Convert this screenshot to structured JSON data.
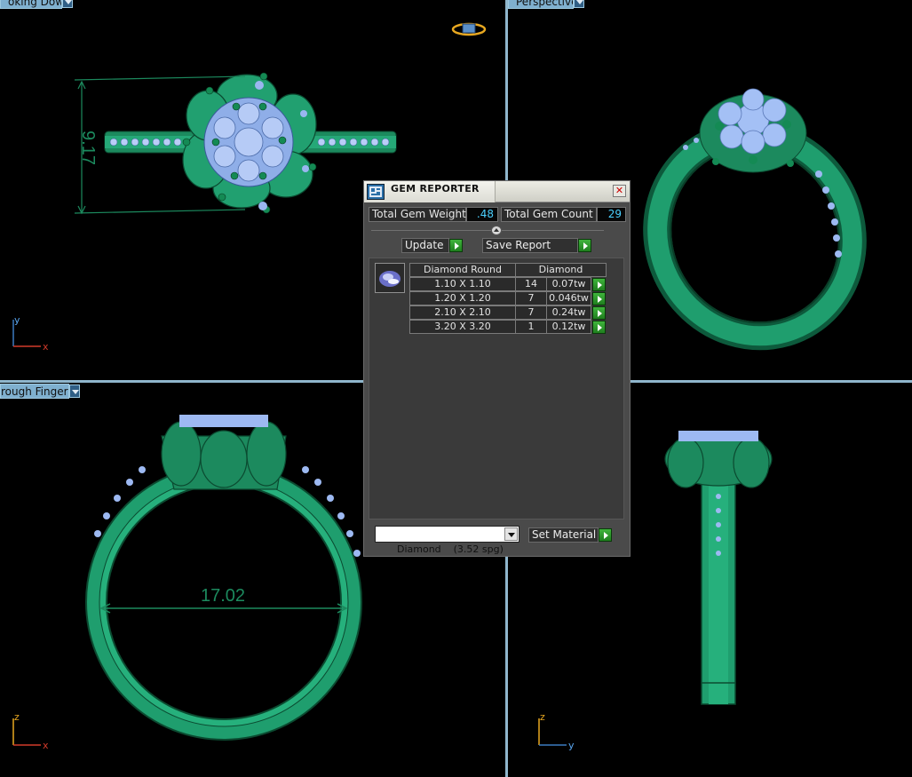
{
  "viewports": {
    "top_left": {
      "label": "oking Down"
    },
    "top_right": {
      "label": "Perspective"
    },
    "bottom_left": {
      "label": "rough Finger"
    }
  },
  "dimensions": {
    "top_view": "9.17",
    "front_view": "17.02"
  },
  "axes": {
    "top_left": {
      "vertical": "y",
      "horizontal": "x"
    },
    "bottom_left": {
      "vertical": "z",
      "horizontal": "x"
    },
    "bottom_right": {
      "vertical": "z",
      "horizontal": "y"
    }
  },
  "gem_reporter": {
    "title": "GEM REPORTER",
    "close_glyph": "✕",
    "total_gem_weight_label": "Total Gem Weight",
    "total_gem_weight": ".48",
    "total_gem_count_label": "Total Gem Count",
    "total_gem_count": "29",
    "update_label": "Update",
    "save_report_label": "Save Report",
    "table": {
      "headers": [
        "Diamond Round",
        "Diamond"
      ],
      "rows": [
        {
          "size": "1.10 X 1.10",
          "count": "14",
          "weight": "0.07tw"
        },
        {
          "size": "1.20 X 1.20",
          "count": "7",
          "weight": "0.046tw"
        },
        {
          "size": "2.10 X 2.10",
          "count": "7",
          "weight": "0.24tw"
        },
        {
          "size": "3.20 X 3.20",
          "count": "1",
          "weight": "0.12tw"
        }
      ]
    },
    "material_value": "Diamond    (3.52 spg)",
    "set_material_label": "Set Material"
  },
  "colors": {
    "metal": "#1f9e6e",
    "metal_dark": "#0d5a3c",
    "gem": "#9db9f2",
    "viewport_label_bg": "#7fb0cf",
    "value_text": "#4ad0ff"
  },
  "icons": {
    "view_cube": "view-cube-icon",
    "gem_thumbnail": "gem-icon",
    "app_icon": "gem-reporter-app-icon"
  }
}
